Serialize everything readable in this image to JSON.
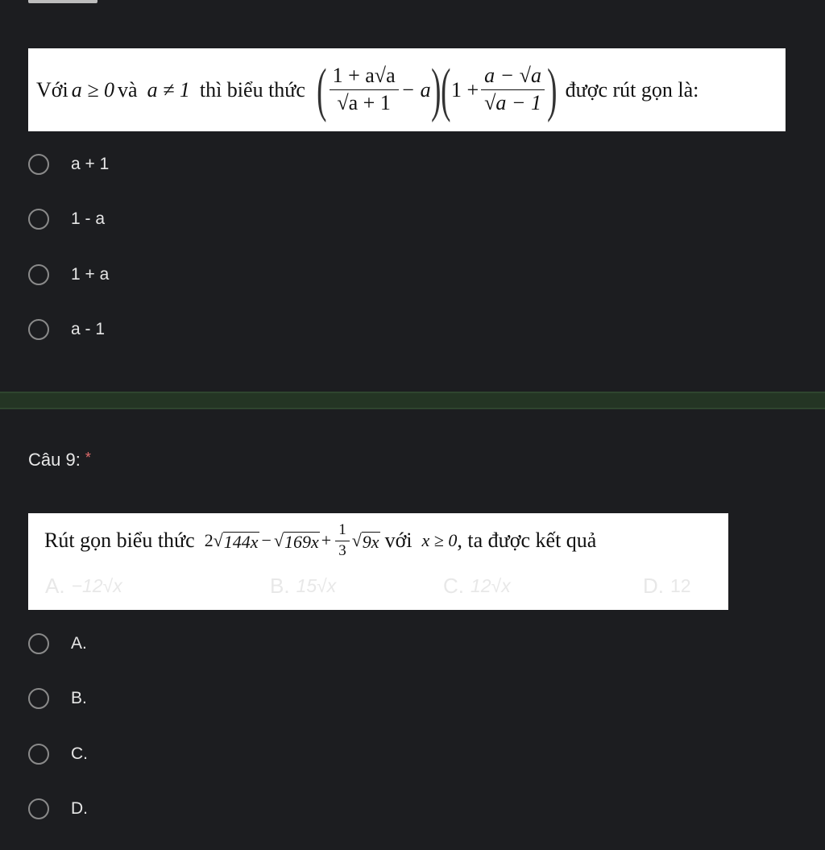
{
  "question8": {
    "image_text": {
      "prefix": "Với",
      "cond1": "a ≥ 0",
      "and": "và",
      "cond2": "a ≠ 1",
      "middle": "thì biểu thức",
      "suffix": "được rút gọn là:",
      "frac1_num": "1 + a√a",
      "frac1_den": "√a + 1",
      "minus_a": "− a",
      "one_plus": "1 +",
      "frac2_num": "a − √a",
      "frac2_den": "√a − 1"
    },
    "options": [
      "a + 1",
      "1 - a",
      "1 + a",
      "a - 1"
    ]
  },
  "question9": {
    "title": "Câu 9:",
    "required_mark": "*",
    "image_text": {
      "prefix": "Rút gọn biểu thức",
      "term1_coef": "2",
      "term1_rad": "144x",
      "minus": "−",
      "term2_rad": "169x",
      "plus": "+",
      "frac_num": "1",
      "frac_den": "3",
      "term3_rad": "9x",
      "with": "với",
      "cond": "x ≥ 0",
      "suffix": ", ta được kết quả",
      "choices": [
        {
          "label": "A.",
          "value": "−12√x"
        },
        {
          "label": "B.",
          "value": "15√x"
        },
        {
          "label": "C.",
          "value": "12√x"
        },
        {
          "label": "D.",
          "value": "12"
        }
      ]
    },
    "options": [
      "A.",
      "B.",
      "C.",
      "D."
    ]
  }
}
